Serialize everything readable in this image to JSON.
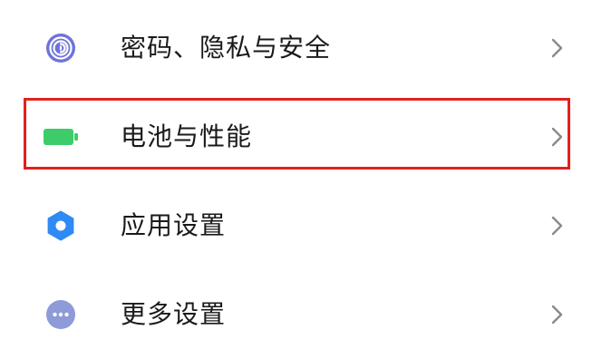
{
  "settings": {
    "items": [
      {
        "id": "privacy",
        "label": "密码、隐私与安全",
        "icon": "fingerprint-icon",
        "icon_color": "#6f73d8"
      },
      {
        "id": "battery",
        "label": "电池与性能",
        "icon": "battery-icon",
        "icon_color": "#3ccd6a",
        "highlighted": true
      },
      {
        "id": "apps",
        "label": "应用设置",
        "icon": "gear-icon",
        "icon_color": "#2f8af5"
      },
      {
        "id": "more",
        "label": "更多设置",
        "icon": "more-dots-icon",
        "icon_color": "#8f9ad8"
      }
    ]
  },
  "highlight_color": "#e3201c"
}
